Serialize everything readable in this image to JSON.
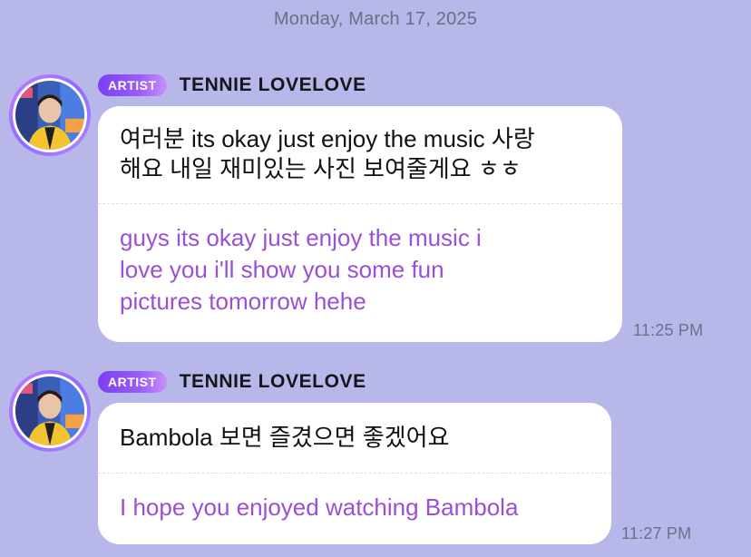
{
  "date_header": "Monday, March 17, 2025",
  "messages": [
    {
      "badge": "ARTIST",
      "sender": "TENNIE LOVELOVE",
      "original_lines": [
        "여러분 its okay just enjoy the music 사랑",
        "해요 내일 재미있는 사진 보여줄게요 ㅎㅎ"
      ],
      "translation_lines": [
        "guys its okay just enjoy the music i",
        "love you i'll show you some fun",
        "pictures tomorrow hehe"
      ],
      "time": "11:25 PM"
    },
    {
      "badge": "ARTIST",
      "sender": "TENNIE LOVELOVE",
      "original_lines": [
        "Bambola 보면 즐겼으면 좋겠어요"
      ],
      "translation_lines": [
        "I hope you enjoyed watching Bambola"
      ],
      "time": "11:27 PM"
    }
  ],
  "colors": {
    "background": "#b8b7e9",
    "badge_start": "#7b3ff2",
    "badge_end": "#c891fb",
    "translation_text": "#9a4fd6",
    "timestamp_text": "#6e7088"
  },
  "icons": {
    "avatar": "artist-profile-photo"
  }
}
